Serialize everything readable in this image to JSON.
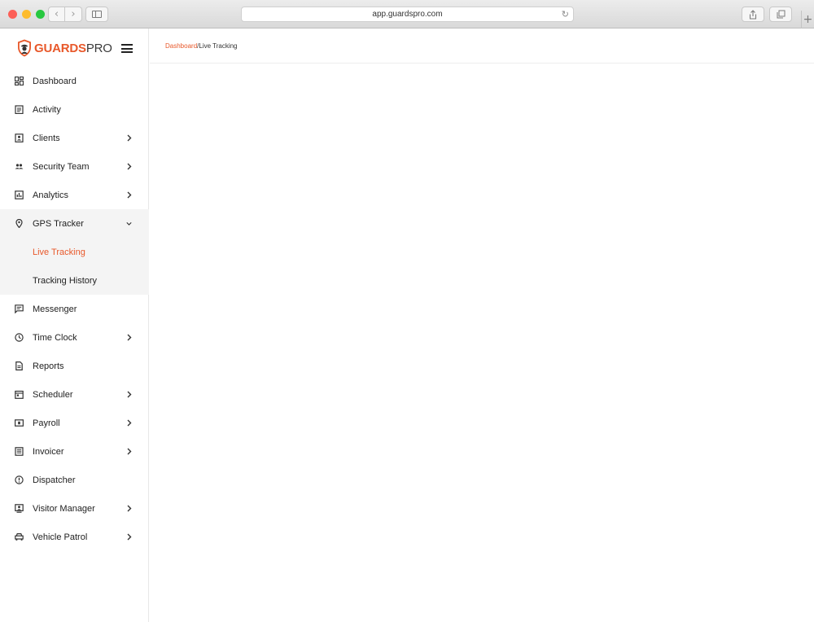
{
  "browser": {
    "url": "app.guardspro.com",
    "icons": [
      "back-icon",
      "forward-icon",
      "sidebar-toggle-icon",
      "reload-icon",
      "share-icon",
      "tabs-icon",
      "new-tab-icon"
    ]
  },
  "brand": {
    "name_accent": "GUARDS",
    "name_rest": "PRO",
    "accent_color": "#e8582a"
  },
  "sidebar": {
    "items": [
      {
        "label": "Dashboard",
        "icon": "dashboard-icon"
      },
      {
        "label": "Activity",
        "icon": "clipboard-icon"
      },
      {
        "label": "Clients",
        "icon": "contact-card-icon",
        "expandable": true
      },
      {
        "label": "Security Team",
        "icon": "people-icon",
        "expandable": true
      },
      {
        "label": "Analytics",
        "icon": "chart-icon",
        "expandable": true
      },
      {
        "label": "GPS Tracker",
        "icon": "location-pin-icon",
        "expanded": true,
        "children": [
          {
            "label": "Live Tracking",
            "active": true
          },
          {
            "label": "Tracking History"
          }
        ]
      },
      {
        "label": "Messenger",
        "icon": "message-icon"
      },
      {
        "label": "Time Clock",
        "icon": "clock-icon",
        "expandable": true
      },
      {
        "label": "Reports",
        "icon": "document-icon"
      },
      {
        "label": "Scheduler",
        "icon": "calendar-icon",
        "expandable": true
      },
      {
        "label": "Payroll",
        "icon": "money-icon",
        "expandable": true
      },
      {
        "label": "Invoicer",
        "icon": "invoice-icon",
        "expandable": true
      },
      {
        "label": "Dispatcher",
        "icon": "alert-icon"
      },
      {
        "label": "Visitor Manager",
        "icon": "visitor-icon",
        "expandable": true
      },
      {
        "label": "Vehicle Patrol",
        "icon": "car-icon",
        "expandable": true
      }
    ]
  },
  "breadcrumb": {
    "parent": "Dashboard",
    "separator": "/",
    "current": "Live Tracking"
  }
}
